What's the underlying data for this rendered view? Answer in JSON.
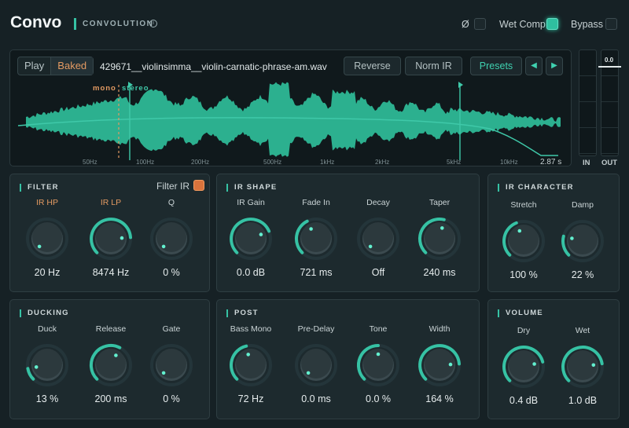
{
  "header": {
    "title": "Convo",
    "subtitle": "CONVOLUTION",
    "info_icon": "i",
    "phase_label": "Ø",
    "wet_comp_label": "Wet Comp",
    "wet_comp_on": true,
    "bypass_label": "Bypass",
    "bypass_on": false,
    "phase_on": false
  },
  "waveform": {
    "play_label": "Play",
    "baked_label": "Baked",
    "active_mode": "Baked",
    "file_name": "429671__violinsimma__violin-carnatic-phrase-am.wav",
    "reverse_label": "Reverse",
    "norm_label": "Norm IR",
    "presets_label": "Presets",
    "prev_label": "◀",
    "next_label": "▶",
    "mono_label": "mono",
    "stereo_label": "stereo",
    "freq_labels": [
      "50Hz",
      "100Hz",
      "200Hz",
      "500Hz",
      "1kHz",
      "2kHz",
      "5kHz",
      "10kHz"
    ],
    "duration": "2.87 s",
    "accent": "#36c9a8"
  },
  "meters": {
    "in_label": "IN",
    "out_label": "OUT",
    "out_reading": "0.0"
  },
  "panels": {
    "filter": {
      "title": "FILTER",
      "filter_ir_label": "Filter IR",
      "filter_ir_on": true,
      "knobs": [
        {
          "label": "IR HP",
          "value": "20 Hz",
          "level": 0.0,
          "orange": true
        },
        {
          "label": "IR LP",
          "value": "8474 Hz",
          "level": 0.82,
          "orange": true
        },
        {
          "label": "Q",
          "value": "0 %",
          "level": 0.0,
          "orange": false
        }
      ]
    },
    "ir_shape": {
      "title": "IR SHAPE",
      "knobs": [
        {
          "label": "IR Gain",
          "value": "0.0 dB",
          "level": 0.75
        },
        {
          "label": "Fade In",
          "value": "721 ms",
          "level": 0.4
        },
        {
          "label": "Decay",
          "value": "Off",
          "level": 0.0
        },
        {
          "label": "Taper",
          "value": "240 ms",
          "level": 0.55
        }
      ]
    },
    "ir_character": {
      "title": "IR CHARACTER",
      "knobs": [
        {
          "label": "Stretch",
          "value": "100 %",
          "level": 0.42
        },
        {
          "label": "Damp",
          "value": "22 %",
          "level": 0.22
        }
      ]
    },
    "ducking": {
      "title": "DUCKING",
      "knobs": [
        {
          "label": "Duck",
          "value": "13 %",
          "level": 0.13
        },
        {
          "label": "Release",
          "value": "200 ms",
          "level": 0.6
        },
        {
          "label": "Gate",
          "value": "0 %",
          "level": 0.0
        }
      ]
    },
    "post": {
      "title": "POST",
      "knobs": [
        {
          "label": "Bass Mono",
          "value": "72 Hz",
          "level": 0.45
        },
        {
          "label": "Pre-Delay",
          "value": "0.0 ms",
          "level": 0.0
        },
        {
          "label": "Tone",
          "value": "0.0 %",
          "level": 0.5
        },
        {
          "label": "Width",
          "value": "164 %",
          "level": 0.82
        }
      ]
    },
    "volume": {
      "title": "VOLUME",
      "knobs": [
        {
          "label": "Dry",
          "value": "0.4 dB",
          "level": 0.78
        },
        {
          "label": "Wet",
          "value": "1.0 dB",
          "level": 0.8
        }
      ]
    }
  }
}
